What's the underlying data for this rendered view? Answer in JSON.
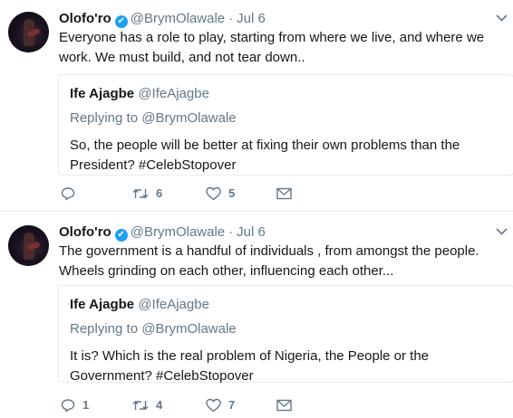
{
  "tweets": [
    {
      "author_name": "Olofo'ro",
      "verified_glyph": "✔",
      "handle": "@BrymOlawale",
      "separator": "·",
      "date": "Jul 6",
      "text": "Everyone has a role to play, starting from where we live, and where we work. We must build, and not tear down..",
      "quote": {
        "author_name": "Ife Ajagbe",
        "handle": "@IfeAjagbe",
        "replying_label": "Replying to",
        "replying_handle": "@BrymOlawale",
        "text": "So, the people will be better at fixing their own problems than the President? #CelebStopover"
      },
      "actions": {
        "reply_count": "",
        "retweet_count": "6",
        "like_count": "5"
      }
    },
    {
      "author_name": "Olofo'ro",
      "verified_glyph": "✔",
      "handle": "@BrymOlawale",
      "separator": "·",
      "date": "Jul 6",
      "text": "The government is a handful of individuals , from amongst the people. Wheels grinding on each other, influencing each other...",
      "quote": {
        "author_name": "Ife Ajagbe",
        "handle": "@IfeAjagbe",
        "replying_label": "Replying to",
        "replying_handle": "@BrymOlawale",
        "text": "It is? Which is the real problem of Nigeria, the People or the Government? #CelebStopover"
      },
      "actions": {
        "reply_count": "1",
        "retweet_count": "4",
        "like_count": "7"
      }
    }
  ],
  "icons": {
    "reply": "reply-icon",
    "retweet": "retweet-icon",
    "like": "heart-icon",
    "dm": "envelope-icon",
    "more": "chevron-down-icon"
  },
  "colors": {
    "verified": "#1da1f2",
    "muted": "#657786",
    "text": "#14171a",
    "border": "#e6ecf0"
  }
}
